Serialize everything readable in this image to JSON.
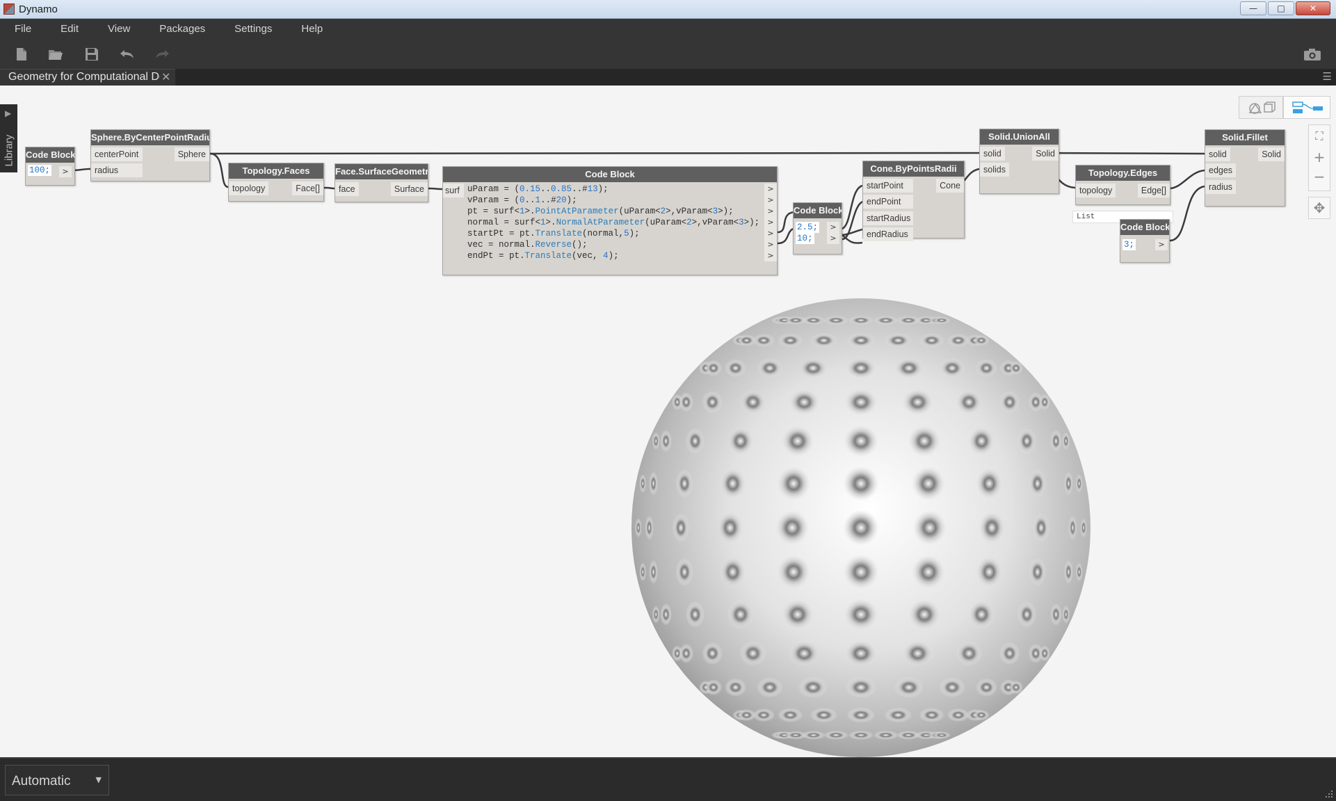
{
  "window": {
    "title": "Dynamo",
    "minimize": "—",
    "maximize": "□",
    "close": "✕"
  },
  "menu": [
    "File",
    "Edit",
    "View",
    "Packages",
    "Settings",
    "Help"
  ],
  "toolbar": {
    "icons": [
      "new-file-icon",
      "open-folder-icon",
      "save-icon",
      "undo-icon",
      "redo-icon",
      "camera-icon"
    ]
  },
  "tab": {
    "label": "Geometry for Computational Design",
    "close": "✕",
    "menu": "☰"
  },
  "library": {
    "label": "Library",
    "arrow": "▶"
  },
  "nodes": {
    "code_block_1": {
      "title": "Code Block",
      "value": "100;",
      "out": ">"
    },
    "sphere": {
      "title": "Sphere.ByCenterPointRadius",
      "in1": "centerPoint",
      "in2": "radius",
      "out": "Sphere"
    },
    "faces": {
      "title": "Topology.Faces",
      "in1": "topology",
      "out": "Face[]"
    },
    "surface": {
      "title": "Face.SurfaceGeometry",
      "in1": "face",
      "out": "Surface"
    },
    "code_block_2": {
      "title": "Code Block",
      "in1": "surf",
      "lines": [
        "uParam = (0.15..0.85..#13);",
        "vParam = (0..1..#20);",
        "pt = surf<1>.PointAtParameter(uParam<2>,vParam<3>);",
        "normal = surf<1>.NormalAtParameter(uParam<2>,vParam<3>);",
        "startPt = pt.Translate(normal,5);",
        "vec = normal.Reverse();",
        "endPt = pt.Translate(vec, 4);"
      ],
      "out": ">"
    },
    "code_block_3": {
      "title": "Code Block",
      "line1": "2.5;",
      "line2": "10;",
      "out": ">"
    },
    "cone": {
      "title": "Cone.ByPointsRadii",
      "in1": "startPoint",
      "in2": "endPoint",
      "in3": "startRadius",
      "in4": "endRadius",
      "out": "Cone"
    },
    "union": {
      "title": "Solid.UnionAll",
      "in1": "solid",
      "in2": "solids",
      "out": "Solid"
    },
    "edges": {
      "title": "Topology.Edges",
      "in1": "topology",
      "out": "Edge[]",
      "preview": "List"
    },
    "code_block_4": {
      "title": "Code Block",
      "value": "3;",
      "out": ">"
    },
    "fillet": {
      "title": "Solid.Fillet",
      "in1": "solid",
      "in2": "edges",
      "in3": "radius",
      "out": "Solid"
    }
  },
  "navigation": {
    "zoom_fit": "⛶",
    "zoom_in": "+",
    "zoom_out": "−",
    "pan": "✥"
  },
  "run": {
    "mode": "Automatic",
    "caret": "▼"
  },
  "colors": {
    "node_header": "#5f5f5f",
    "node_body": "#d7d4cf",
    "workspace": "#f4f4f4",
    "chrome": "#353535",
    "accent": "#3aa0e0"
  }
}
